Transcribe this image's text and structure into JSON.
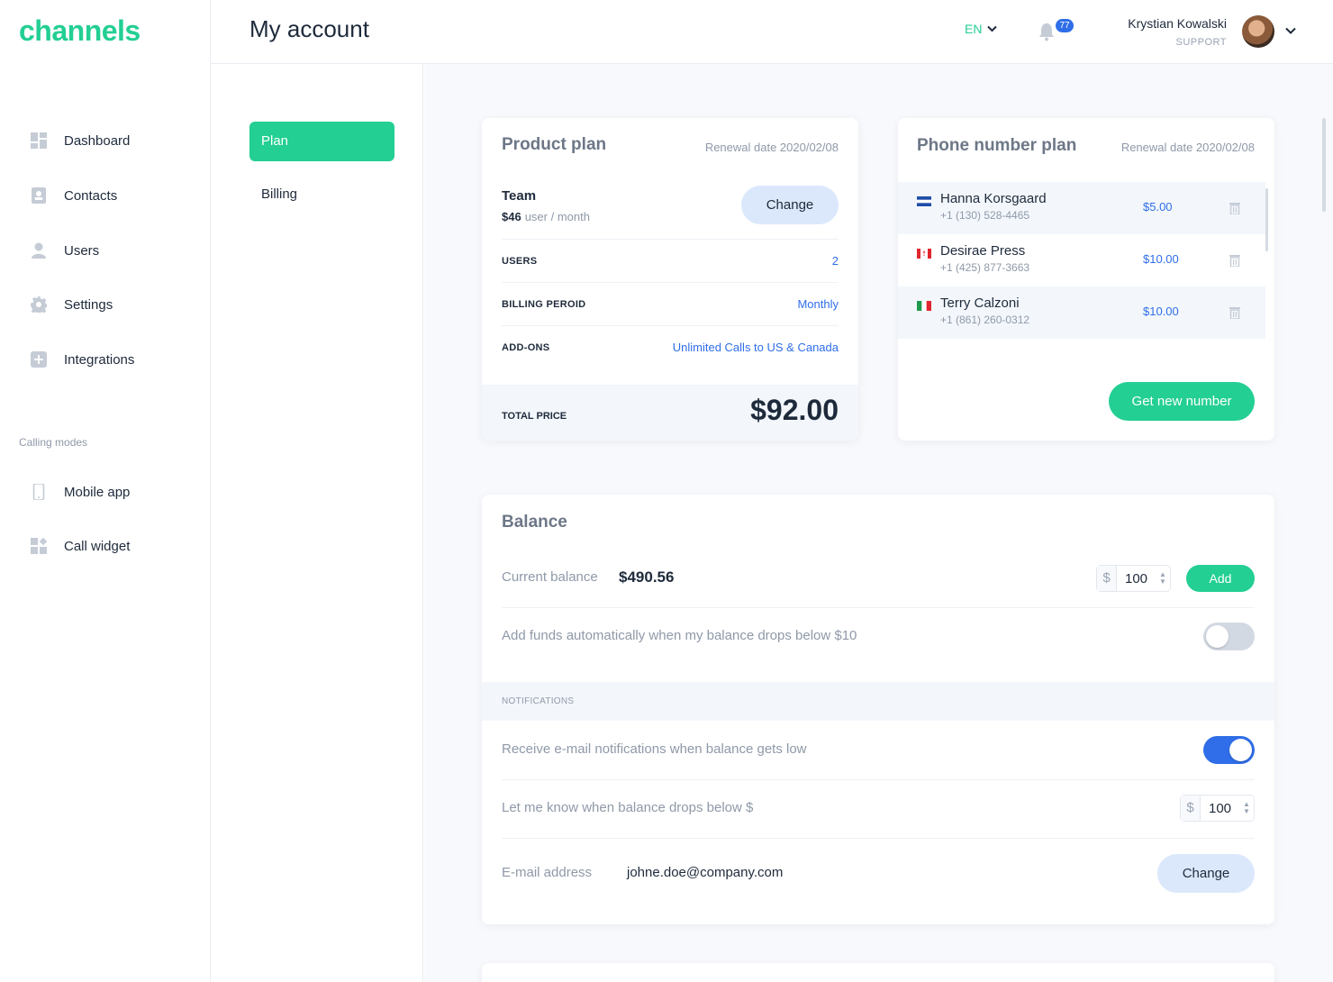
{
  "brand": {
    "logo": "channels",
    "accent": "#23cf93",
    "link": "#2f6ee8"
  },
  "sidebar": {
    "items": [
      {
        "label": "Dashboard",
        "icon": "dashboard-icon"
      },
      {
        "label": "Contacts",
        "icon": "contacts-icon"
      },
      {
        "label": "Users",
        "icon": "user-icon"
      },
      {
        "label": "Settings",
        "icon": "gear-icon"
      },
      {
        "label": "Integrations",
        "icon": "plus-square-icon"
      }
    ],
    "section_label": "Calling modes",
    "modes": [
      {
        "label": "Mobile app",
        "icon": "mobile-icon"
      },
      {
        "label": "Call widget",
        "icon": "widget-icon"
      }
    ]
  },
  "header": {
    "title": "My account",
    "lang": "EN",
    "notifications": "77",
    "user_name": "Krystian Kowalski",
    "user_role": "SUPPORT"
  },
  "subnav": {
    "plan": "Plan",
    "billing": "Billing"
  },
  "product_plan": {
    "title": "Product plan",
    "renewal": "Renewal date 2020/02/08",
    "plan_name": "Team",
    "plan_price": "$46",
    "plan_unit": "user / month",
    "change_label": "Change",
    "rows": [
      {
        "key": "USERS",
        "value": "2"
      },
      {
        "key": "BILLING PEROID",
        "value": "Monthly"
      },
      {
        "key": "ADD-ONS",
        "value": "Unlimited Calls to US & Canada"
      }
    ],
    "total_label": "TOTAL PRICE",
    "total_value": "$92.00"
  },
  "phone_plan": {
    "title": "Phone number plan",
    "renewal": "Renewal date 2020/02/08",
    "numbers": [
      {
        "name": "Hanna Korsgaard",
        "number": "+1 (130) 528-4465",
        "price": "$5.00",
        "flag": "el-salvador"
      },
      {
        "name": "Desirae Press",
        "number": "+1 (425) 877-3663",
        "price": "$10.00",
        "flag": "canada"
      },
      {
        "name": "Terry Calzoni",
        "number": "+1 (861) 260-0312",
        "price": "$10.00",
        "flag": "italy"
      }
    ],
    "button": "Get new number"
  },
  "balance": {
    "title": "Balance",
    "current_label": "Current balance",
    "current_value": "$490.56",
    "currency": "$",
    "add_amount": "100",
    "add_button": "Add",
    "auto_label": "Add funds automatically when my balance drops below $10",
    "auto_on": false,
    "notifications_label": "NOTIFICATIONS",
    "email_notif_label": "Receive e-mail notifications when balance gets low",
    "email_notif_on": true,
    "threshold_label": "Let me know when balance drops below $",
    "threshold_amount": "100",
    "email_label": "E-mail address",
    "email_value": "johne.doe@company.com",
    "email_change": "Change"
  }
}
